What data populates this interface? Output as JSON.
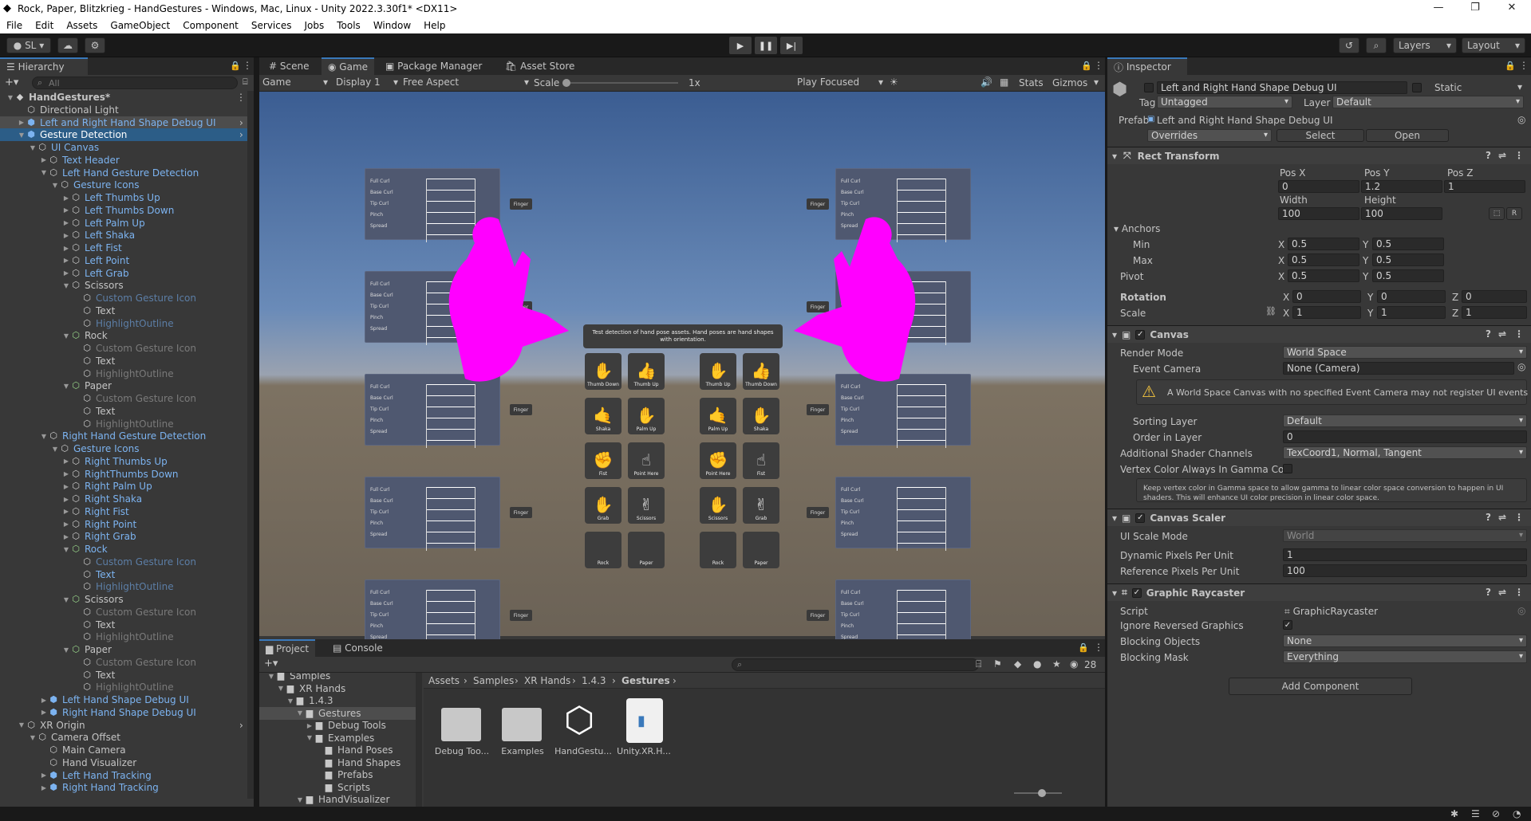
{
  "window": {
    "title": "Rock, Paper, Blitzkrieg - HandGestures - Windows, Mac, Linux - Unity 2022.3.30f1* <DX11>"
  },
  "menu": [
    "File",
    "Edit",
    "Assets",
    "GameObject",
    "Component",
    "Services",
    "Jobs",
    "Tools",
    "Window",
    "Help"
  ],
  "toolbar": {
    "account": "SL",
    "layers": "Layers",
    "layout": "Layout"
  },
  "hierarchy": {
    "tab": "Hierarchy",
    "search_placeholder": "All",
    "rows": [
      {
        "label": "HandGestures*",
        "depth": 0,
        "arrow": "▼",
        "icon": "unity",
        "style": "bold"
      },
      {
        "label": "Directional Light",
        "depth": 1,
        "arrow": "",
        "icon": "go",
        "style": ""
      },
      {
        "label": "Left and Right Hand Shape Debug UI",
        "depth": 1,
        "arrow": "▶",
        "icon": "prefab",
        "style": "prefab",
        "sel": "dark"
      },
      {
        "label": "Gesture Detection",
        "depth": 1,
        "arrow": "▼",
        "icon": "prefab",
        "style": "prefab",
        "sel": "blue"
      },
      {
        "label": "UI Canvas",
        "depth": 2,
        "arrow": "▼",
        "icon": "go",
        "style": "prefab"
      },
      {
        "label": "Text Header",
        "depth": 3,
        "arrow": "▶",
        "icon": "go",
        "style": "prefab"
      },
      {
        "label": "Left Hand Gesture Detection",
        "depth": 3,
        "arrow": "▼",
        "icon": "go",
        "style": "prefab"
      },
      {
        "label": "Gesture Icons",
        "depth": 4,
        "arrow": "▼",
        "icon": "go",
        "style": "prefab"
      },
      {
        "label": "Left Thumbs Up",
        "depth": 5,
        "arrow": "▶",
        "icon": "go",
        "style": "prefab"
      },
      {
        "label": "Left Thumbs Down",
        "depth": 5,
        "arrow": "▶",
        "icon": "go",
        "style": "prefab"
      },
      {
        "label": "Left Palm Up",
        "depth": 5,
        "arrow": "▶",
        "icon": "go",
        "style": "prefab"
      },
      {
        "label": "Left Shaka",
        "depth": 5,
        "arrow": "▶",
        "icon": "go",
        "style": "prefab"
      },
      {
        "label": "Left Fist",
        "depth": 5,
        "arrow": "▶",
        "icon": "go",
        "style": "prefab"
      },
      {
        "label": "Left Point",
        "depth": 5,
        "arrow": "▶",
        "icon": "go",
        "style": "prefab"
      },
      {
        "label": "Left Grab",
        "depth": 5,
        "arrow": "▶",
        "icon": "go",
        "style": "prefab"
      },
      {
        "label": "Scissors",
        "depth": 5,
        "arrow": "▼",
        "icon": "go",
        "style": ""
      },
      {
        "label": "Custom Gesture Icon",
        "depth": 6,
        "arrow": "",
        "icon": "go",
        "style": "bluedim"
      },
      {
        "label": "Text",
        "depth": 6,
        "arrow": "",
        "icon": "go",
        "style": ""
      },
      {
        "label": "HighlightOutline",
        "depth": 6,
        "arrow": "",
        "icon": "go",
        "style": "bluedim"
      },
      {
        "label": "Rock",
        "depth": 5,
        "arrow": "▼",
        "icon": "add",
        "style": ""
      },
      {
        "label": "Custom Gesture Icon",
        "depth": 6,
        "arrow": "",
        "icon": "go",
        "style": "dim"
      },
      {
        "label": "Text",
        "depth": 6,
        "arrow": "",
        "icon": "go",
        "style": ""
      },
      {
        "label": "HighlightOutline",
        "depth": 6,
        "arrow": "",
        "icon": "go",
        "style": "dim"
      },
      {
        "label": "Paper",
        "depth": 5,
        "arrow": "▼",
        "icon": "add",
        "style": ""
      },
      {
        "label": "Custom Gesture Icon",
        "depth": 6,
        "arrow": "",
        "icon": "go",
        "style": "dim"
      },
      {
        "label": "Text",
        "depth": 6,
        "arrow": "",
        "icon": "go",
        "style": ""
      },
      {
        "label": "HighlightOutline",
        "depth": 6,
        "arrow": "",
        "icon": "go",
        "style": "dim"
      },
      {
        "label": "Right Hand Gesture Detection",
        "depth": 3,
        "arrow": "▼",
        "icon": "go",
        "style": "prefab"
      },
      {
        "label": "Gesture Icons",
        "depth": 4,
        "arrow": "▼",
        "icon": "go",
        "style": "prefab"
      },
      {
        "label": "Right Thumbs Up",
        "depth": 5,
        "arrow": "▶",
        "icon": "go",
        "style": "prefab"
      },
      {
        "label": "RightThumbs Down",
        "depth": 5,
        "arrow": "▶",
        "icon": "go",
        "style": "prefab"
      },
      {
        "label": "Right Palm Up",
        "depth": 5,
        "arrow": "▶",
        "icon": "go",
        "style": "prefab"
      },
      {
        "label": "Right Shaka",
        "depth": 5,
        "arrow": "▶",
        "icon": "go",
        "style": "prefab"
      },
      {
        "label": "Right Fist",
        "depth": 5,
        "arrow": "▶",
        "icon": "go",
        "style": "prefab"
      },
      {
        "label": "Right Point",
        "depth": 5,
        "arrow": "▶",
        "icon": "go",
        "style": "prefab"
      },
      {
        "label": "Right Grab",
        "depth": 5,
        "arrow": "▶",
        "icon": "go",
        "style": "prefab"
      },
      {
        "label": "Rock",
        "depth": 5,
        "arrow": "▼",
        "icon": "add",
        "style": "prefab"
      },
      {
        "label": "Custom Gesture Icon",
        "depth": 6,
        "arrow": "",
        "icon": "go",
        "style": "bluedim"
      },
      {
        "label": "Text",
        "depth": 6,
        "arrow": "",
        "icon": "go",
        "style": "prefab"
      },
      {
        "label": "HighlightOutline",
        "depth": 6,
        "arrow": "",
        "icon": "go",
        "style": "bluedim"
      },
      {
        "label": "Scissors",
        "depth": 5,
        "arrow": "▼",
        "icon": "add",
        "style": ""
      },
      {
        "label": "Custom Gesture Icon",
        "depth": 6,
        "arrow": "",
        "icon": "go",
        "style": "dim"
      },
      {
        "label": "Text",
        "depth": 6,
        "arrow": "",
        "icon": "go",
        "style": ""
      },
      {
        "label": "HighlightOutline",
        "depth": 6,
        "arrow": "",
        "icon": "go",
        "style": "dim"
      },
      {
        "label": "Paper",
        "depth": 5,
        "arrow": "▼",
        "icon": "add",
        "style": ""
      },
      {
        "label": "Custom Gesture Icon",
        "depth": 6,
        "arrow": "",
        "icon": "go",
        "style": "dim"
      },
      {
        "label": "Text",
        "depth": 6,
        "arrow": "",
        "icon": "go",
        "style": ""
      },
      {
        "label": "HighlightOutline",
        "depth": 6,
        "arrow": "",
        "icon": "go",
        "style": "dim"
      },
      {
        "label": "Left Hand Shape Debug UI",
        "depth": 3,
        "arrow": "▶",
        "icon": "prefab",
        "style": "prefab"
      },
      {
        "label": "Right Hand Shape Debug UI",
        "depth": 3,
        "arrow": "▶",
        "icon": "prefab",
        "style": "prefab"
      },
      {
        "label": "XR Origin",
        "depth": 1,
        "arrow": "▼",
        "icon": "go",
        "style": ""
      },
      {
        "label": "Camera Offset",
        "depth": 2,
        "arrow": "▼",
        "icon": "go",
        "style": ""
      },
      {
        "label": "Main Camera",
        "depth": 3,
        "arrow": "",
        "icon": "go",
        "style": ""
      },
      {
        "label": "Hand Visualizer",
        "depth": 3,
        "arrow": "",
        "icon": "go",
        "style": ""
      },
      {
        "label": "Left Hand Tracking",
        "depth": 3,
        "arrow": "▶",
        "icon": "prefab",
        "style": "prefab"
      },
      {
        "label": "Right Hand Tracking",
        "depth": 3,
        "arrow": "▶",
        "icon": "prefab",
        "style": "prefab"
      }
    ]
  },
  "center_tabs": [
    "Scene",
    "Game",
    "Package Manager",
    "Asset Store"
  ],
  "game_toolbar": {
    "game": "Game",
    "display": "Display 1",
    "aspect": "Free Aspect",
    "scale_label": "Scale",
    "scale_value": "1x",
    "play_focused": "Play Focused",
    "stats": "Stats",
    "gizmos": "Gizmos"
  },
  "scene": {
    "card_rows": [
      "Full Curl",
      "Base Curl",
      "Tip Curl",
      "Pinch",
      "Spread"
    ],
    "finger_label": "Finger",
    "header_text": "Test detection of hand pose assets. Hand poses are hand shapes with orientation.",
    "left_icons": [
      "Thumb Down",
      "Thumb Up",
      "Shaka",
      "Palm Up",
      "Fist",
      "Point Here",
      "Grab",
      "Scissors",
      "Rock",
      "Paper"
    ],
    "right_icons": [
      "Thumb Up",
      "Thumb Down",
      "Palm Up",
      "Shaka",
      "Point Here",
      "Fist",
      "Scissors",
      "Grab",
      "Rock",
      "Paper"
    ]
  },
  "project": {
    "tabs": [
      "Project",
      "Console"
    ],
    "count": "28",
    "tree": [
      {
        "label": "Samples",
        "depth": 0
      },
      {
        "label": "XR Hands",
        "depth": 1
      },
      {
        "label": "1.4.3",
        "depth": 2
      },
      {
        "label": "Gestures",
        "depth": 3,
        "sel": true
      },
      {
        "label": "Debug Tools",
        "depth": 4
      },
      {
        "label": "Examples",
        "depth": 4
      },
      {
        "label": "Hand Poses",
        "depth": 5
      },
      {
        "label": "Hand Shapes",
        "depth": 5
      },
      {
        "label": "Prefabs",
        "depth": 5
      },
      {
        "label": "Scripts",
        "depth": 5
      },
      {
        "label": "HandVisualizer",
        "depth": 3
      }
    ],
    "breadcrumb": [
      "Assets",
      "Samples",
      "XR Hands",
      "1.4.3",
      "Gestures"
    ],
    "assets": [
      "Debug Too...",
      "Examples",
      "HandGestu...",
      "Unity.XR.H..."
    ]
  },
  "inspector": {
    "tab": "Inspector",
    "object_name": "Left and Right Hand Shape Debug UI",
    "static_label": "Static",
    "tag_label": "Tag",
    "tag": "Untagged",
    "layer_label": "Layer",
    "layer": "Default",
    "prefab_label": "Prefab",
    "prefab": "Left and Right Hand Shape Debug UI",
    "overrides": "Overrides",
    "select": "Select",
    "open": "Open",
    "rect": {
      "title": "Rect Transform",
      "posx_l": "Pos X",
      "posy_l": "Pos Y",
      "posz_l": "Pos Z",
      "posx": "0",
      "posy": "1.2",
      "posz": "1",
      "width_l": "Width",
      "height_l": "Height",
      "width": "100",
      "height": "100",
      "anchors": "Anchors",
      "min": "Min",
      "max": "Max",
      "pivot": "Pivot",
      "rotation": "Rotation",
      "scale": "Scale",
      "minx": "0.5",
      "miny": "0.5",
      "maxx": "0.5",
      "maxy": "0.5",
      "pivx": "0.5",
      "pivy": "0.5",
      "rotx": "0",
      "roty": "0",
      "rotz": "0",
      "scx": "1",
      "scy": "1",
      "scz": "1"
    },
    "canvas": {
      "title": "Canvas",
      "render_mode_l": "Render Mode",
      "render_mode": "World Space",
      "event_camera_l": "Event Camera",
      "event_camera": "None (Camera)",
      "warning": "A World Space Canvas with no specified Event Camera may not register UI events correctly.",
      "sorting_layer_l": "Sorting Layer",
      "sorting_layer": "Default",
      "order_l": "Order in Layer",
      "order": "0",
      "shader_l": "Additional Shader Channels",
      "shader": "TexCoord1, Normal, Tangent",
      "vertex_l": "Vertex Color Always In Gamma Colc",
      "info": "Keep vertex color in Gamma space to allow gamma to linear color space conversion to happen in UI shaders. This will enhance UI color precision in linear color space."
    },
    "scaler": {
      "title": "Canvas Scaler",
      "mode_l": "UI Scale Mode",
      "mode": "World",
      "dpu_l": "Dynamic Pixels Per Unit",
      "dpu": "1",
      "rpu_l": "Reference Pixels Per Unit",
      "rpu": "100"
    },
    "raycaster": {
      "title": "Graphic Raycaster",
      "script_l": "Script",
      "script": "GraphicRaycaster",
      "ignore_l": "Ignore Reversed Graphics",
      "blocking_l": "Blocking Objects",
      "blocking": "None",
      "mask_l": "Blocking Mask",
      "mask": "Everything"
    },
    "add_component": "Add Component"
  },
  "colors": {
    "accent": "#3a79bb",
    "prefab_text": "#7cb3f0",
    "hand": "#ff00ff"
  }
}
